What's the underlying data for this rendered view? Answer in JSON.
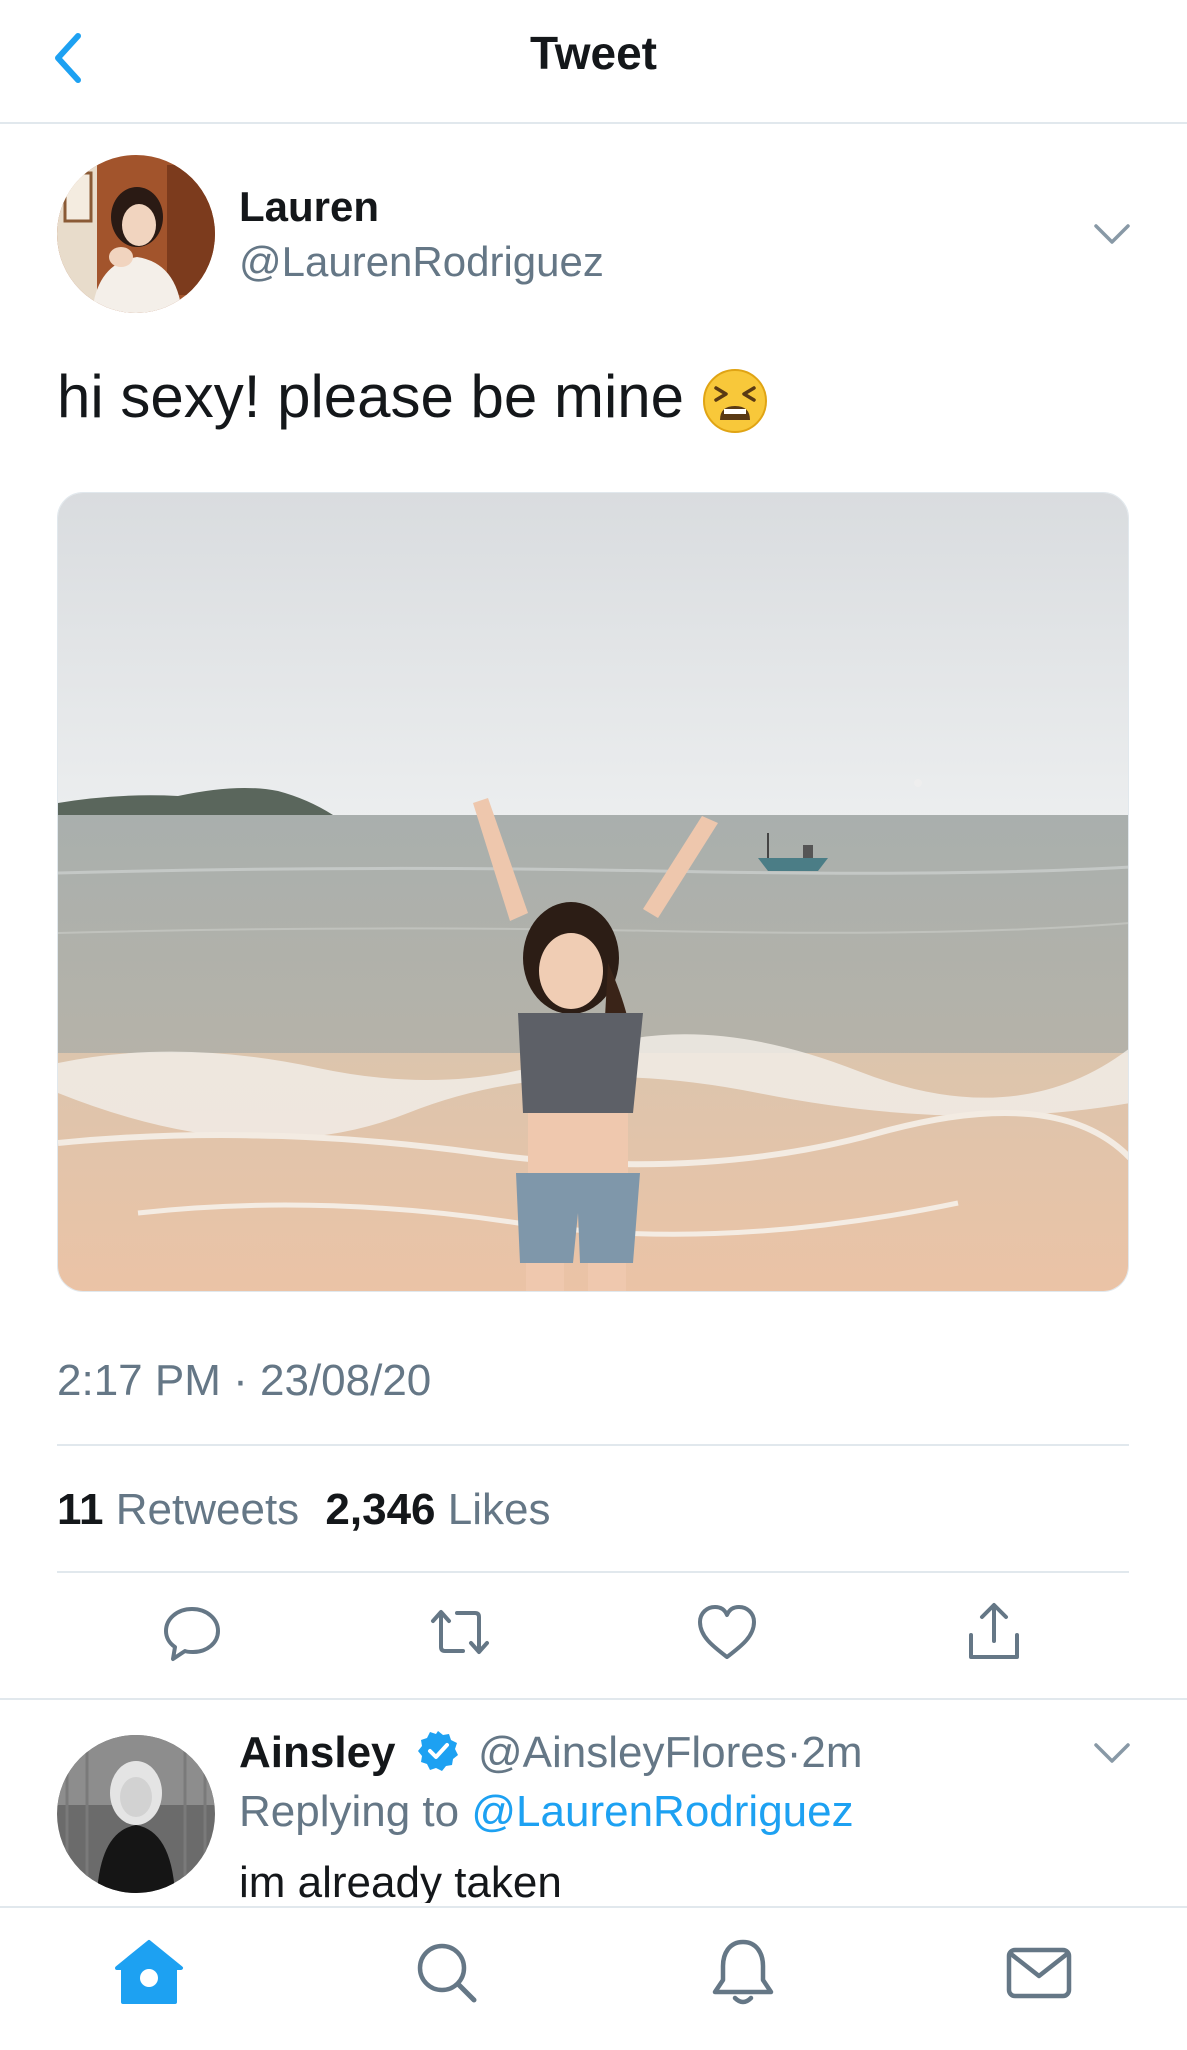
{
  "header": {
    "title": "Tweet",
    "back_icon": "chevron-left-icon"
  },
  "tweet": {
    "name": "Lauren",
    "handle": "@LaurenRodriguez",
    "text": "hi sexy! please be mine",
    "emoji": "tired-face-emoji",
    "time": "2:17 PM",
    "dot": "·",
    "date": "23/08/20",
    "retweets_count": "11",
    "retweets_label": "Retweets",
    "likes_count": "2,346",
    "likes_label": "Likes",
    "actions": [
      "reply-icon",
      "retweet-icon",
      "heart-icon",
      "share-icon"
    ]
  },
  "reply": {
    "name": "Ainsley",
    "verified": true,
    "handle": "@AinsleyFlores",
    "dot": "·",
    "time": "2m",
    "replying_prefix": "Replying to",
    "replying_handle": "@LaurenRodriguez",
    "text": "im already taken"
  },
  "tabbar": {
    "items": [
      "home-icon",
      "search-icon",
      "notifications-icon",
      "messages-icon"
    ],
    "active": "home-icon"
  },
  "colors": {
    "accent": "#1da1f2",
    "secondary_text": "#657786",
    "divider": "#e1e8ed"
  }
}
